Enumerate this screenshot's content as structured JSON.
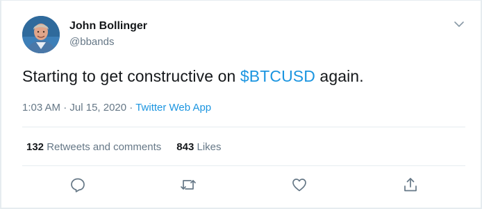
{
  "author": {
    "name": "John Bollinger",
    "handle": "@bbands"
  },
  "tweet": {
    "text_before": "Starting to get constructive on ",
    "cashtag": "$BTCUSD",
    "text_after": " again."
  },
  "meta": {
    "time": "1:03 AM",
    "separator1": " · ",
    "date": "Jul 15, 2020",
    "separator2": " · ",
    "source": "Twitter Web App"
  },
  "stats": {
    "retweets_count": "132",
    "retweets_label": "Retweets and comments",
    "likes_count": "843",
    "likes_label": "Likes"
  },
  "icons": {
    "caret": "chevron-down-icon",
    "reply": "reply-icon",
    "retweet": "retweet-icon",
    "like": "heart-icon",
    "share": "share-icon"
  },
  "colors": {
    "link": "#1b95e0",
    "text": "#14171a",
    "secondary": "#657786",
    "divider": "#e6ecf0"
  }
}
